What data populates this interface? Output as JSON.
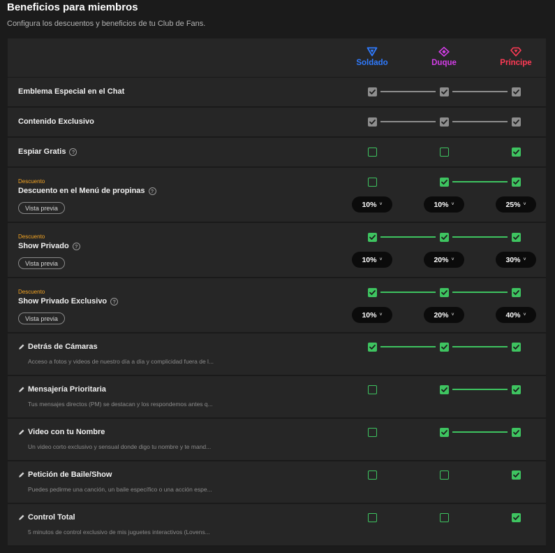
{
  "header": {
    "title": "Beneficios para miembros",
    "subtitle": "Configura los descuentos y beneficios de tu Club de Fans."
  },
  "tiers": [
    {
      "name": "Soldado",
      "color": "#2f7bff",
      "icon": "triangle-icon"
    },
    {
      "name": "Duque",
      "color": "#d43ee8",
      "icon": "diamond-icon"
    },
    {
      "name": "Príncipe",
      "color": "#ff3a55",
      "icon": "gem-icon"
    }
  ],
  "colors": {
    "green": "#3ec460",
    "gray": "#8e8e8e",
    "orange": "#f5a524"
  },
  "rows": [
    {
      "type": "simple",
      "label": "Emblema Especial en el Chat",
      "help": false,
      "checks": [
        "gray",
        "gray",
        "gray"
      ]
    },
    {
      "type": "simple",
      "label": "Contenido Exclusivo",
      "help": false,
      "checks": [
        "gray",
        "gray",
        "gray"
      ]
    },
    {
      "type": "simple",
      "label": "Espiar Gratis",
      "help": true,
      "checks": [
        "off",
        "off",
        "on"
      ]
    },
    {
      "type": "discount",
      "tag": "Descuento",
      "label": "Descuento en el Menú de propinas",
      "help": true,
      "preview": "Vista previa",
      "checks": [
        "off",
        "on",
        "on"
      ],
      "percents": [
        "10%",
        "10%",
        "25%"
      ]
    },
    {
      "type": "discount",
      "tag": "Descuento",
      "label": "Show Privado",
      "help": true,
      "preview": "Vista previa",
      "checks": [
        "on",
        "on",
        "on"
      ],
      "percents": [
        "10%",
        "20%",
        "30%"
      ]
    },
    {
      "type": "discount",
      "tag": "Descuento",
      "label": "Show Privado Exclusivo",
      "help": true,
      "preview": "Vista previa",
      "checks": [
        "on",
        "on",
        "on"
      ],
      "percents": [
        "10%",
        "20%",
        "40%"
      ]
    },
    {
      "type": "custom",
      "label": "Detrás de Cámaras",
      "desc": "Acceso a fotos y videos de nuestro día a día y complicidad fuera de l...",
      "checks": [
        "on",
        "on",
        "on"
      ]
    },
    {
      "type": "custom",
      "label": "Mensajería Prioritaria",
      "desc": "Tus mensajes directos (PM) se destacan y los respondemos antes q...",
      "checks": [
        "off",
        "on",
        "on"
      ]
    },
    {
      "type": "custom",
      "label": "Video con tu Nombre",
      "desc": "Un video corto exclusivo y sensual donde digo tu nombre y te mand...",
      "checks": [
        "off",
        "on",
        "on"
      ]
    },
    {
      "type": "custom",
      "label": "Petición de Baile/Show",
      "desc": "Puedes pedirme una canción, un baile específico o una acción espe...",
      "checks": [
        "off",
        "off",
        "on"
      ]
    },
    {
      "type": "custom",
      "label": "Control Total",
      "desc": "5 minutos de control exclusivo de mis juguetes interactivos (Lovens...",
      "checks": [
        "off",
        "off",
        "on"
      ]
    }
  ]
}
